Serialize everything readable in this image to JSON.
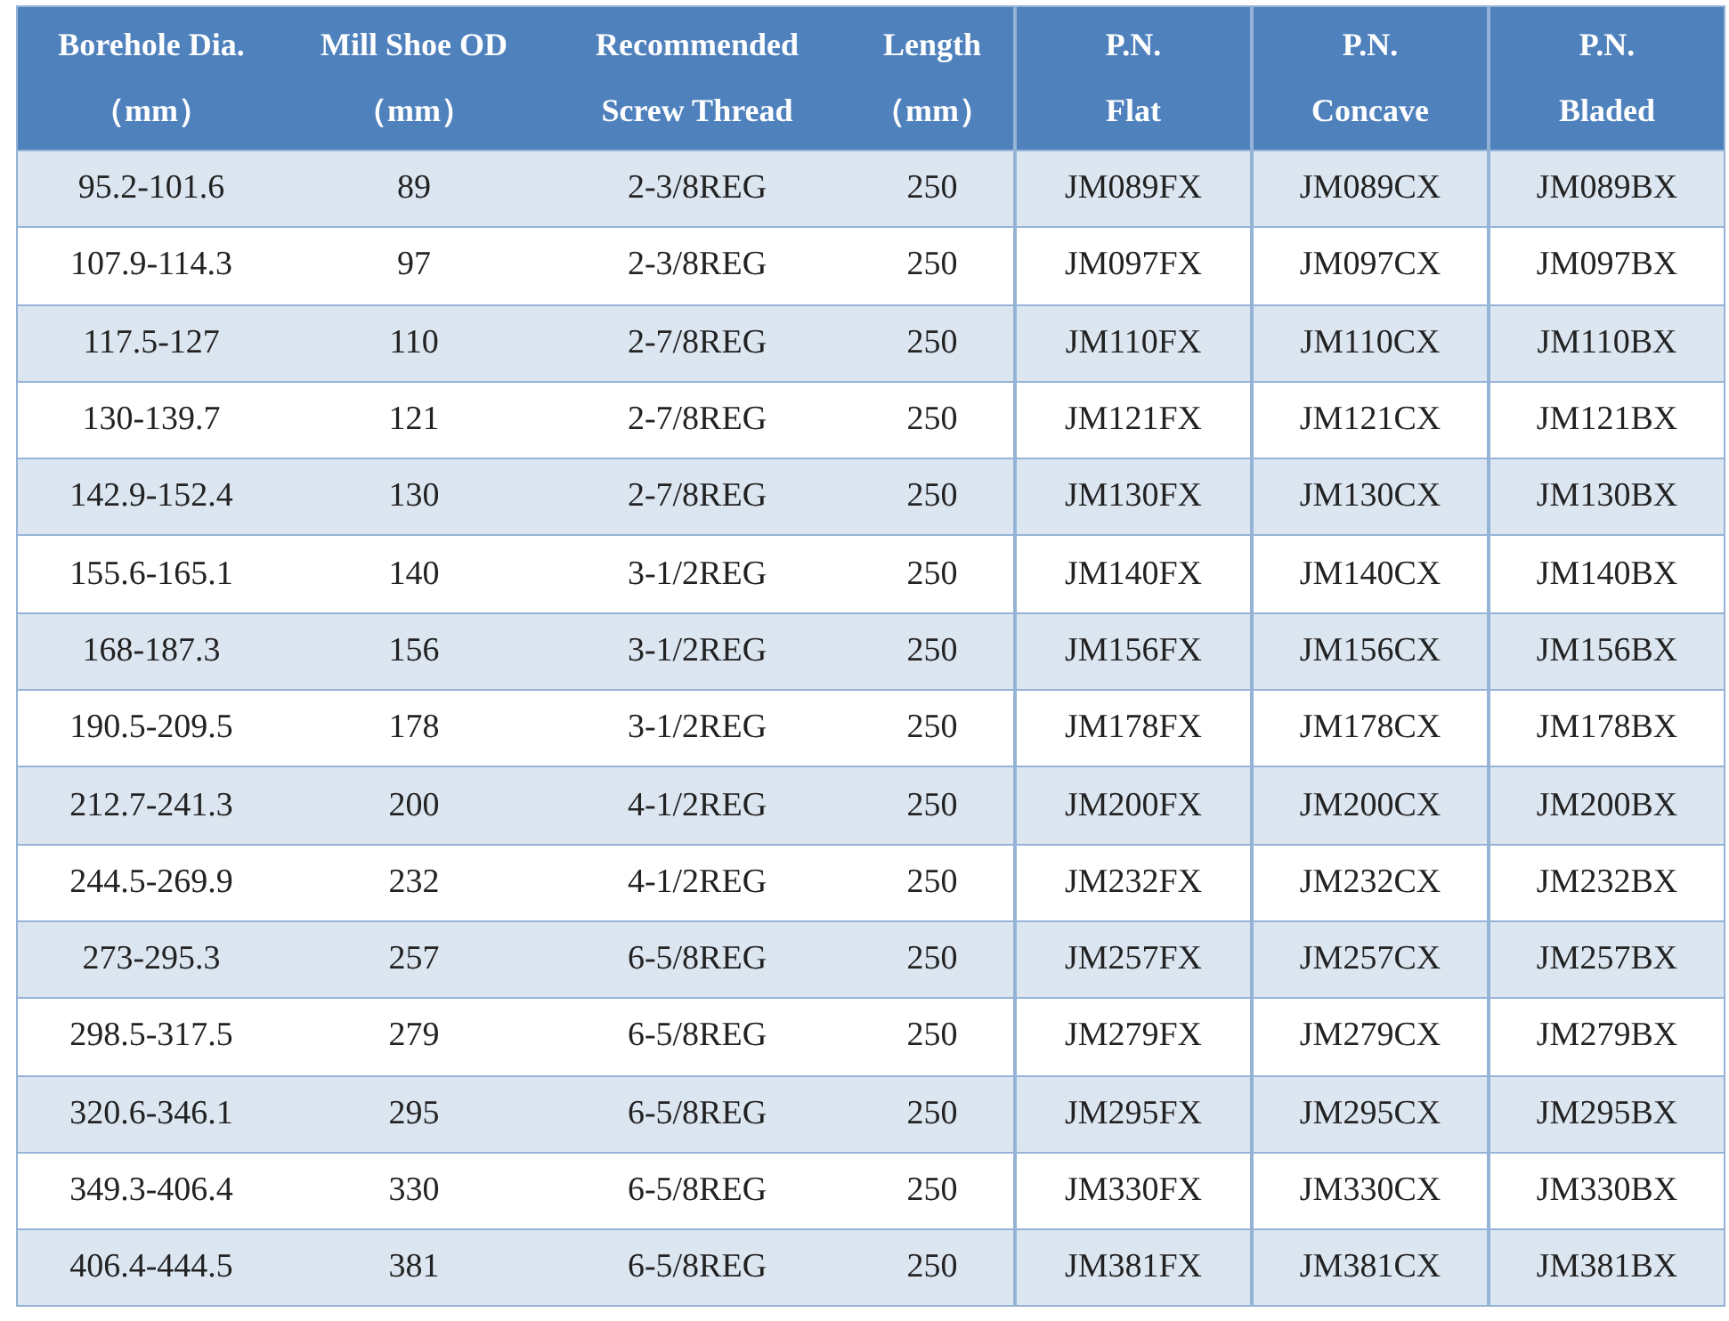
{
  "table": {
    "columns": [
      {
        "lines": [
          "Borehole Dia.",
          "（mm）"
        ]
      },
      {
        "lines": [
          "Mill Shoe OD",
          "（mm）"
        ]
      },
      {
        "lines": [
          "Recommended",
          "Screw Thread"
        ]
      },
      {
        "lines": [
          "Length",
          "（mm）"
        ]
      },
      {
        "lines": [
          "P.N.",
          "Flat"
        ]
      },
      {
        "lines": [
          "P.N.",
          "Concave"
        ]
      },
      {
        "lines": [
          "P.N.",
          "Bladed"
        ]
      }
    ],
    "rows": [
      [
        "95.2-101.6",
        "89",
        "2-3/8REG",
        "250",
        "JM089FX",
        "JM089CX",
        "JM089BX"
      ],
      [
        "107.9-114.3",
        "97",
        "2-3/8REG",
        "250",
        "JM097FX",
        "JM097CX",
        "JM097BX"
      ],
      [
        "117.5-127",
        "110",
        "2-7/8REG",
        "250",
        "JM110FX",
        "JM110CX",
        "JM110BX"
      ],
      [
        "130-139.7",
        "121",
        "2-7/8REG",
        "250",
        "JM121FX",
        "JM121CX",
        "JM121BX"
      ],
      [
        "142.9-152.4",
        "130",
        "2-7/8REG",
        "250",
        "JM130FX",
        "JM130CX",
        "JM130BX"
      ],
      [
        "155.6-165.1",
        "140",
        "3-1/2REG",
        "250",
        "JM140FX",
        "JM140CX",
        "JM140BX"
      ],
      [
        "168-187.3",
        "156",
        "3-1/2REG",
        "250",
        "JM156FX",
        "JM156CX",
        "JM156BX"
      ],
      [
        "190.5-209.5",
        "178",
        "3-1/2REG",
        "250",
        "JM178FX",
        "JM178CX",
        "JM178BX"
      ],
      [
        "212.7-241.3",
        "200",
        "4-1/2REG",
        "250",
        "JM200FX",
        "JM200CX",
        "JM200BX"
      ],
      [
        "244.5-269.9",
        "232",
        "4-1/2REG",
        "250",
        "JM232FX",
        "JM232CX",
        "JM232BX"
      ],
      [
        "273-295.3",
        "257",
        "6-5/8REG",
        "250",
        "JM257FX",
        "JM257CX",
        "JM257BX"
      ],
      [
        "298.5-317.5",
        "279",
        "6-5/8REG",
        "250",
        "JM279FX",
        "JM279CX",
        "JM279BX"
      ],
      [
        "320.6-346.1",
        "295",
        "6-5/8REG",
        "250",
        "JM295FX",
        "JM295CX",
        "JM295BX"
      ],
      [
        "349.3-406.4",
        "330",
        "6-5/8REG",
        "250",
        "JM330FX",
        "JM330CX",
        "JM330BX"
      ],
      [
        "406.4-444.5",
        "381",
        "6-5/8REG",
        "250",
        "JM381FX",
        "JM381CX",
        "JM381BX"
      ]
    ]
  }
}
